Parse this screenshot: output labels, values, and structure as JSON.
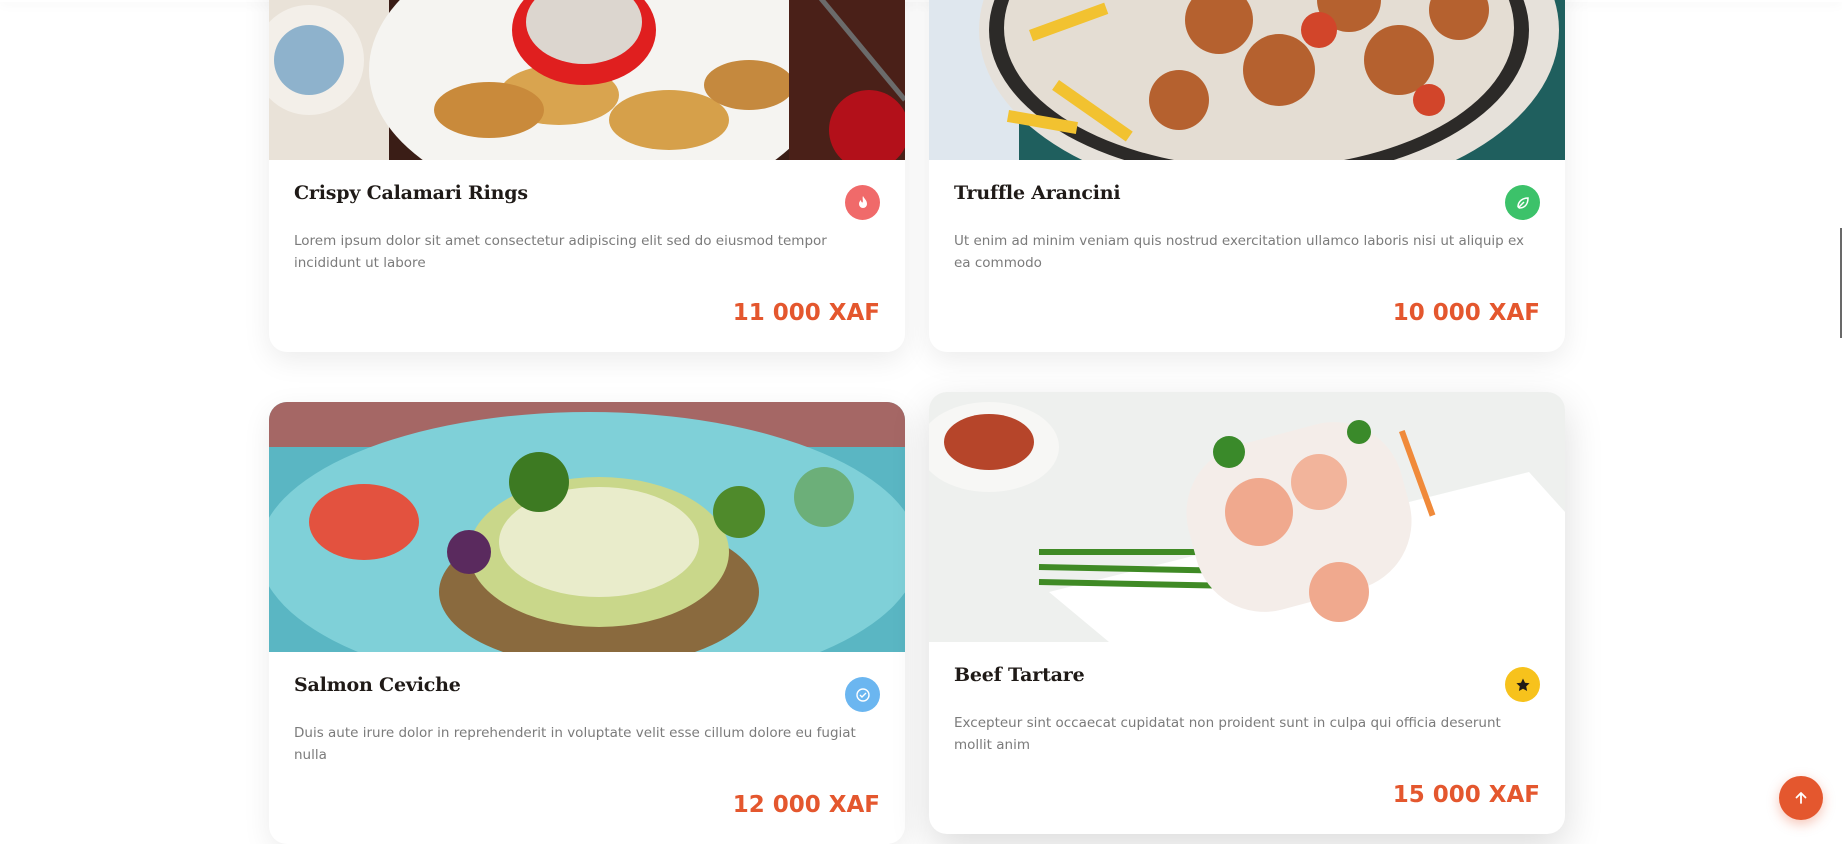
{
  "colors": {
    "accent": "#e4572e",
    "spicy": "#f06a6a",
    "vegan": "#3cc26a",
    "signature": "#6bb6f0",
    "chef": "#f7c21c",
    "title": "#1f1a17",
    "text": "#7b7b7b"
  },
  "menu": {
    "items": [
      {
        "name": "Crispy Calamari Rings",
        "description": "Lorem ipsum dolor sit amet consectetur adipiscing elit sed do eiusmod tempor incididunt ut labore",
        "price": "11 000 XAF",
        "badge_icon": "flame-icon"
      },
      {
        "name": "Truffle Arancini",
        "description": "Ut enim ad minim veniam quis nostrud exercitation ullamco laboris nisi ut aliquip ex ea commodo",
        "price": "10 000 XAF",
        "badge_icon": "leaf-icon"
      },
      {
        "name": "Salmon Ceviche",
        "description": "Duis aute irure dolor in reprehenderit in voluptate velit esse cillum dolore eu fugiat nulla",
        "price": "12 000 XAF",
        "badge_icon": "check-circle-icon"
      },
      {
        "name": "Beef Tartare",
        "description": "Excepteur sint occaecat cupidatat non proident sunt in culpa qui officia deserunt mollit anim",
        "price": "15 000 XAF",
        "badge_icon": "star-icon"
      }
    ]
  },
  "scroll_top": {
    "icon": "arrow-up-icon"
  }
}
